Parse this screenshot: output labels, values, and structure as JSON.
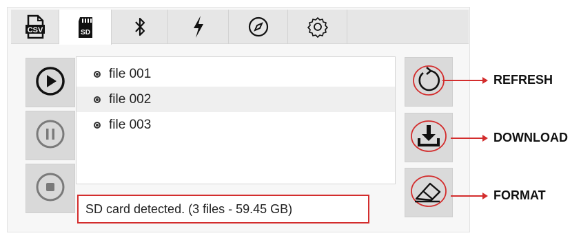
{
  "tabs": [
    {
      "id": "csv",
      "icon": "csv-file-icon",
      "label": "CSV",
      "active": false
    },
    {
      "id": "sd",
      "icon": "sd-card-icon",
      "label": "SD",
      "active": true
    },
    {
      "id": "bluetooth",
      "icon": "bluetooth-icon",
      "active": false
    },
    {
      "id": "power",
      "icon": "lightning-bolt-icon",
      "active": false
    },
    {
      "id": "compass",
      "icon": "compass-icon",
      "active": false
    },
    {
      "id": "settings",
      "icon": "gear-icon",
      "active": false
    }
  ],
  "controls": {
    "play_icon": "play-icon",
    "pause_icon": "pause-icon",
    "stop_icon": "stop-icon"
  },
  "files": [
    {
      "name": "file 001",
      "selected": false
    },
    {
      "name": "file 002",
      "selected": true
    },
    {
      "name": "file 003",
      "selected": false
    }
  ],
  "status_text": "SD card detected. (3 files - 59.45 GB)",
  "actions": {
    "refresh": {
      "label": "REFRESH",
      "icon": "refresh-icon"
    },
    "download": {
      "label": "DOWNLOAD",
      "icon": "download-icon"
    },
    "format": {
      "label": "FORMAT",
      "icon": "eraser-icon"
    }
  },
  "colors": {
    "highlight": "#d32d2d",
    "active_tab": "#ffffff",
    "tab_bar": "#e6e6e6"
  }
}
